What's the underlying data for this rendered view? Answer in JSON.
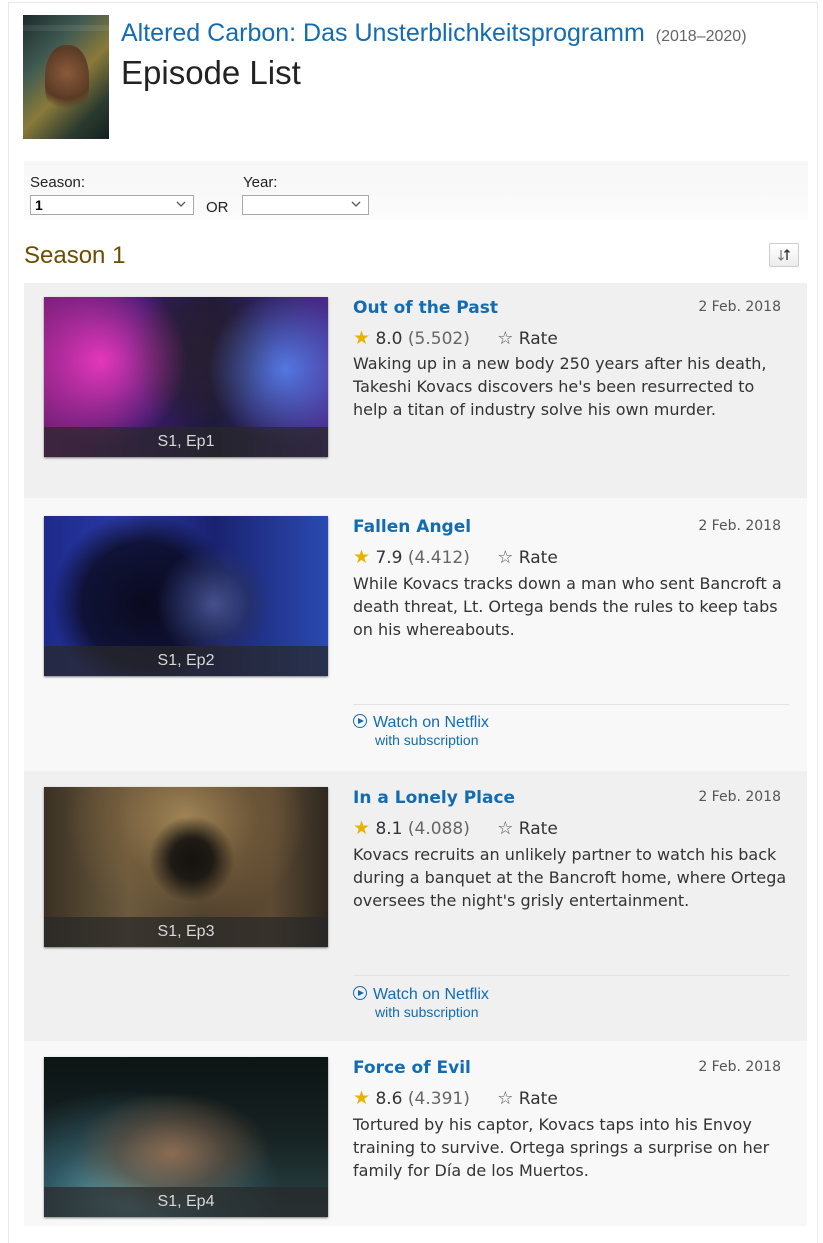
{
  "show": {
    "title": "Altered Carbon: Das Unsterblichkeitsprogramm",
    "years": "(2018–2020)",
    "page_title": "Episode List"
  },
  "filters": {
    "season_label": "Season:",
    "season_value": "1",
    "or_label": "OR",
    "year_label": "Year:",
    "year_value": ""
  },
  "season_heading": "Season 1",
  "sort_icon": "sort-icon",
  "episodes": [
    {
      "caption": "S1, Ep1",
      "title": "Out of the Past",
      "airdate": "2 Feb. 2018",
      "rating": "8.0",
      "votes": "(5.502)",
      "rate_label": "Rate",
      "description": "Waking up in a new body 250 years after his death, Takeshi Kovacs discovers he's been resurrected to help a titan of industry solve his own murder."
    },
    {
      "caption": "S1, Ep2",
      "title": "Fallen Angel",
      "airdate": "2 Feb. 2018",
      "rating": "7.9",
      "votes": "(4.412)",
      "rate_label": "Rate",
      "description": "While Kovacs tracks down a man who sent Bancroft a death threat, Lt. Ortega bends the rules to keep tabs on his whereabouts.",
      "watch_label": "Watch on Netflix",
      "watch_sub": "with subscription"
    },
    {
      "caption": "S1, Ep3",
      "title": "In a Lonely Place",
      "airdate": "2 Feb. 2018",
      "rating": "8.1",
      "votes": "(4.088)",
      "rate_label": "Rate",
      "description": "Kovacs recruits an unlikely partner to watch his back during a banquet at the Bancroft home, where Ortega oversees the night's grisly entertainment.",
      "watch_label": "Watch on Netflix",
      "watch_sub": "with subscription"
    },
    {
      "caption": "S1, Ep4",
      "title": "Force of Evil",
      "airdate": "2 Feb. 2018",
      "rating": "8.6",
      "votes": "(4.391)",
      "rate_label": "Rate",
      "description": "Tortured by his captor, Kovacs taps into his Envoy training to survive. Ortega springs a surprise on her family for Día de los Muertos."
    }
  ]
}
